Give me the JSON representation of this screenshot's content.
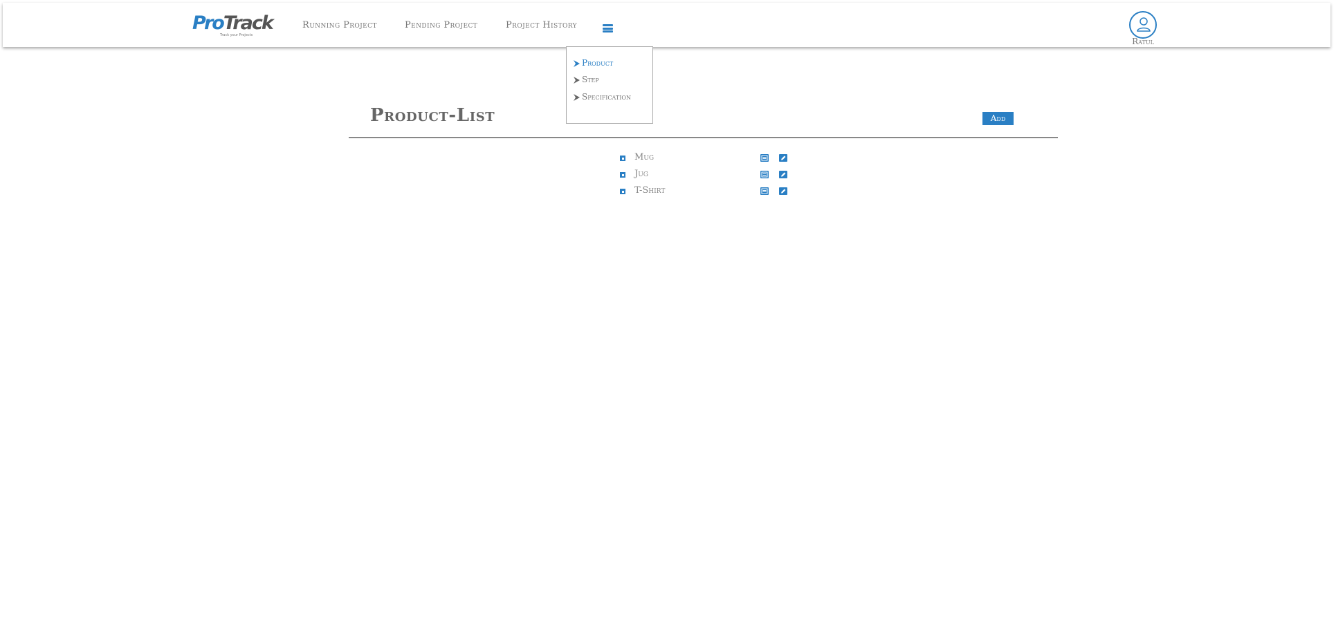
{
  "brand": {
    "logo_pro": "Pro",
    "logo_track": "Track",
    "tagline": "Track your Projects"
  },
  "nav": {
    "links": [
      {
        "label": "Running Project"
      },
      {
        "label": "Pending Project"
      },
      {
        "label": "Project History"
      }
    ],
    "menu_icon": "hamburger-icon"
  },
  "user": {
    "name": "Ratul",
    "avatar_icon": "user-icon"
  },
  "dropdown": {
    "items": [
      {
        "label": "Product",
        "active": true
      },
      {
        "label": "Step",
        "active": false
      },
      {
        "label": "Specification",
        "active": false
      }
    ],
    "chevron_icon": "chevron-right-icon"
  },
  "page": {
    "title": "Product-List",
    "add_label": "Add"
  },
  "products": [
    {
      "name": "Mug"
    },
    {
      "name": "Jug"
    },
    {
      "name": "T-Shirt"
    }
  ],
  "row_actions": {
    "details_icon": "list-icon",
    "edit_icon": "edit-icon"
  },
  "colors": {
    "accent": "#2a7fc4",
    "text": "#777777",
    "divider": "#888888"
  }
}
